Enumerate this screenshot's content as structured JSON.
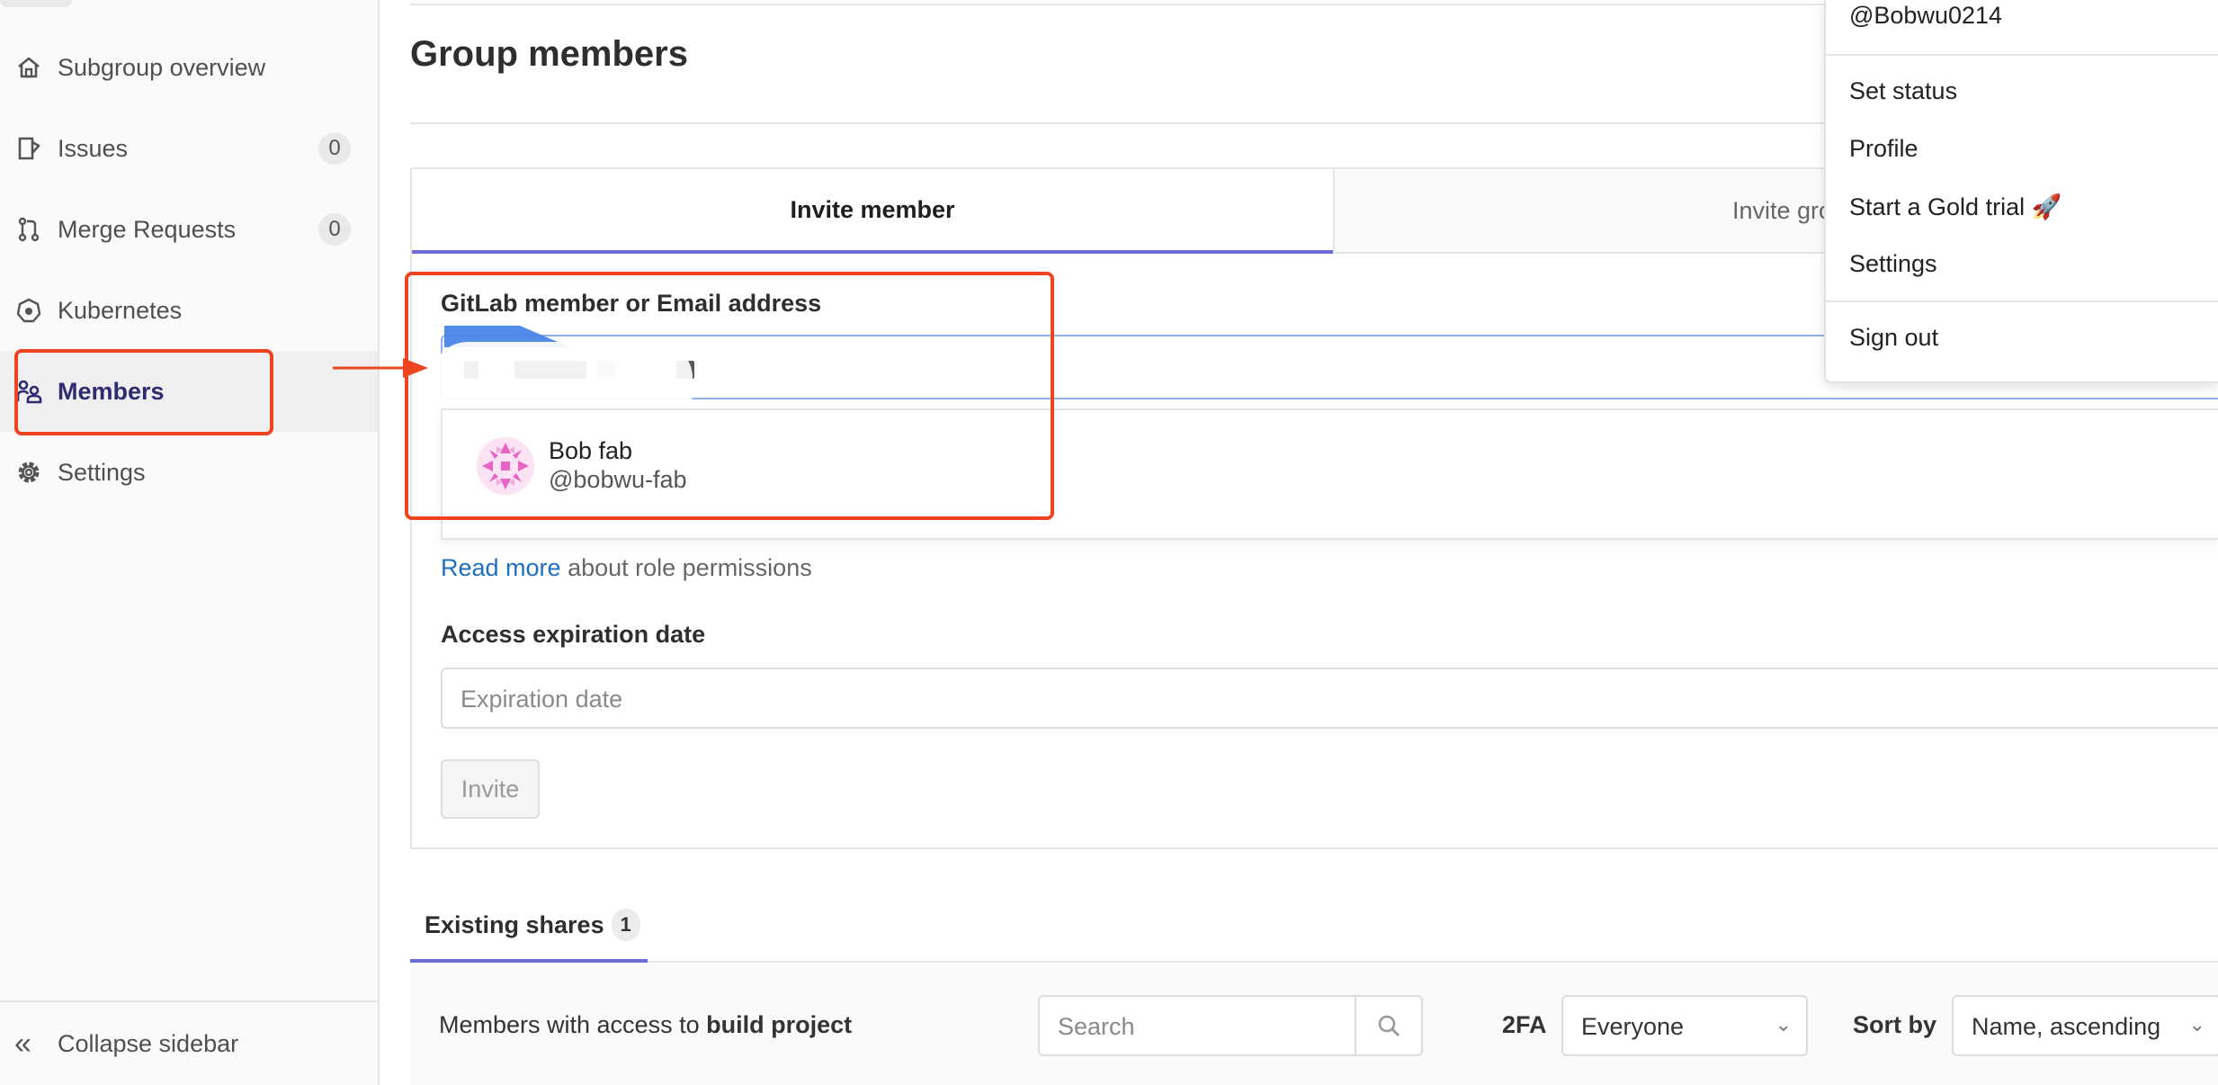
{
  "sidebar": {
    "items": [
      {
        "label": "Subgroup overview",
        "icon": "home-icon"
      },
      {
        "label": "Issues",
        "icon": "issues-icon",
        "badge": "0"
      },
      {
        "label": "Merge Requests",
        "icon": "merge-request-icon",
        "badge": "0"
      },
      {
        "label": "Kubernetes",
        "icon": "kubernetes-icon"
      },
      {
        "label": "Members",
        "icon": "members-icon",
        "active": true
      },
      {
        "label": "Settings",
        "icon": "gear-icon"
      }
    ],
    "collapse_label": "Collapse sidebar"
  },
  "page": {
    "title": "Group members"
  },
  "invite": {
    "tab_member": "Invite member",
    "tab_group": "Invite gro",
    "member_label": "GitLab member or Email address",
    "suggestion": {
      "name": "Bob fab",
      "handle": "@bobwu-fab"
    },
    "help_link": "Read more",
    "help_text": " about role permissions",
    "expiration_label": "Access expiration date",
    "expiration_placeholder": "Expiration date",
    "invite_button": "Invite"
  },
  "shares": {
    "tab_label": "Existing shares",
    "count": "1",
    "members_text_prefix": "Members with access to ",
    "project_name": "build project",
    "search_placeholder": "Search",
    "twofa_label": "2FA",
    "twofa_value": "Everyone",
    "sort_label": "Sort by",
    "sort_value": "Name, ascending"
  },
  "user_menu": {
    "handle": "@Bobwu0214",
    "items": [
      "Set status",
      "Profile",
      "Start a Gold trial 🚀",
      "Settings"
    ],
    "sign_out": "Sign out"
  },
  "colors": {
    "accent": "#6b6bd6",
    "annotation": "#ee4422",
    "link": "#1f6fbf",
    "active_nav": "#2e2c70"
  }
}
